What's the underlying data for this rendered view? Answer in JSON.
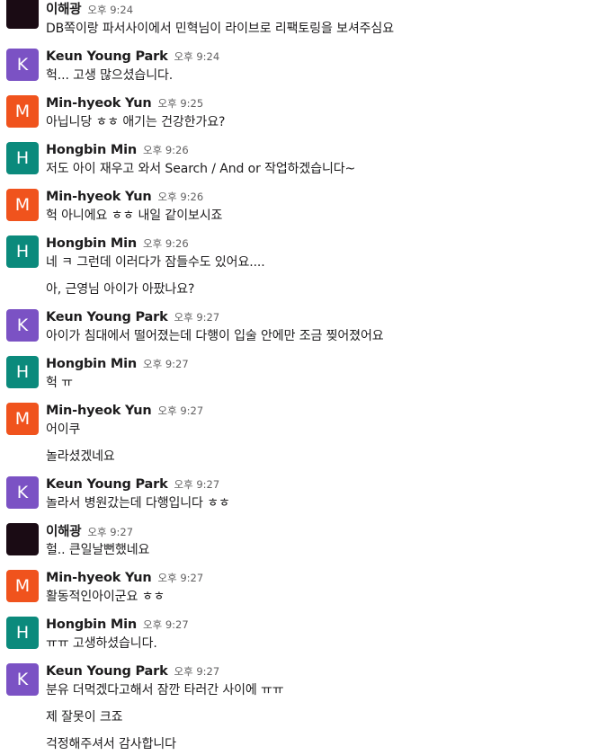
{
  "colors": {
    "K": "#7b52c4",
    "M": "#f0531d",
    "H": "#0b8a7c",
    "이": "#1a0b14"
  },
  "messages": [
    {
      "type": "header",
      "avatar": "",
      "author": "이해광",
      "time": "오후 9:24",
      "text": "DB쪽이랑 파서사이에서 민혁님이 라이브로 리팩토링을 보셔주심요"
    },
    {
      "type": "header",
      "avatar": "K",
      "author": "Keun Young Park",
      "time": "오후 9:24",
      "text": "헉... 고생 많으셨습니다."
    },
    {
      "type": "header",
      "avatar": "M",
      "author": "Min-hyeok Yun",
      "time": "오후 9:25",
      "text": "아닙니당 ㅎㅎ 애기는 건강한가요?"
    },
    {
      "type": "header",
      "avatar": "H",
      "author": "Hongbin Min",
      "time": "오후 9:26",
      "text": "저도 아이 재우고 와서 Search / And or 작업하겠습니다~"
    },
    {
      "type": "header",
      "avatar": "M",
      "author": "Min-hyeok Yun",
      "time": "오후 9:26",
      "text": "헉 아니에요 ㅎㅎ 내일 같이보시죠"
    },
    {
      "type": "header",
      "avatar": "H",
      "author": "Hongbin Min",
      "time": "오후 9:26",
      "text": "네 ㅋ 그런데 이러다가 잠들수도 있어요...."
    },
    {
      "type": "cont",
      "text": "아, 근영님 아이가 아팠나요?"
    },
    {
      "type": "header",
      "avatar": "K",
      "author": "Keun Young Park",
      "time": "오후 9:27",
      "text": "아이가 침대에서 떨어졌는데 다행이 입술 안에만 조금 찢어졌어요"
    },
    {
      "type": "header",
      "avatar": "H",
      "author": "Hongbin Min",
      "time": "오후 9:27",
      "text": "헉 ㅠ"
    },
    {
      "type": "header",
      "avatar": "M",
      "author": "Min-hyeok Yun",
      "time": "오후 9:27",
      "text": "어이쿠"
    },
    {
      "type": "cont",
      "text": "놀라셨겠네요"
    },
    {
      "type": "header",
      "avatar": "K",
      "author": "Keun Young Park",
      "time": "오후 9:27",
      "text": "놀라서 병원갔는데 다행입니다 ㅎㅎ"
    },
    {
      "type": "header",
      "avatar": "",
      "author": "이해광",
      "time": "오후 9:27",
      "text": "헐.. 큰일날뻔했네요"
    },
    {
      "type": "header",
      "avatar": "M",
      "author": "Min-hyeok Yun",
      "time": "오후 9:27",
      "text": "활동적인아이군요 ㅎㅎ"
    },
    {
      "type": "header",
      "avatar": "H",
      "author": "Hongbin Min",
      "time": "오후 9:27",
      "text": "ㅠㅠ 고생하셨습니다."
    },
    {
      "type": "header",
      "avatar": "K",
      "author": "Keun Young Park",
      "time": "오후 9:27",
      "text": "분유 더먹겠다고해서 잠깐 타러간 사이에 ㅠㅠ"
    },
    {
      "type": "cont",
      "text": "제 잘못이 크죠"
    },
    {
      "type": "cont",
      "text": "걱정해주셔서 감사합니다"
    }
  ]
}
